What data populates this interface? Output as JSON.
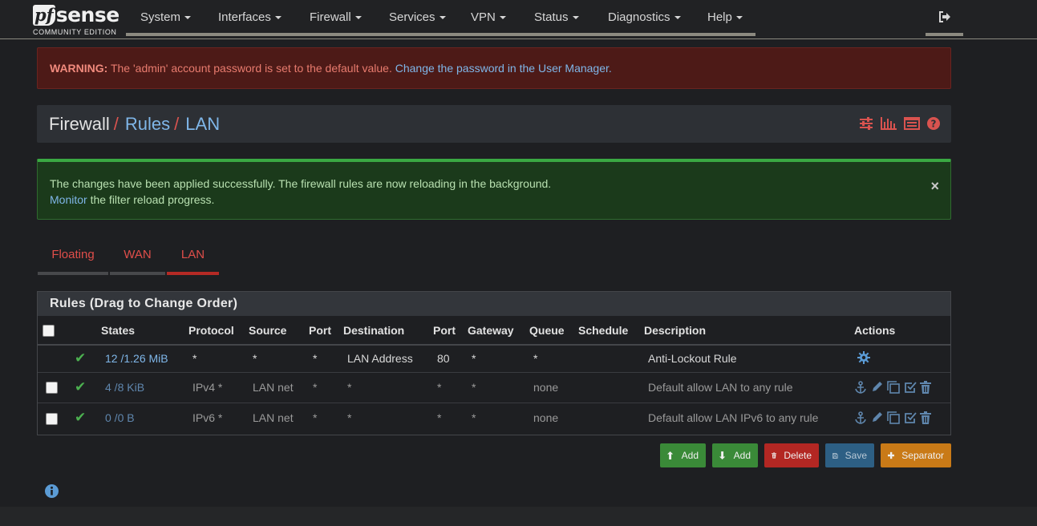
{
  "brand": {
    "logo_pf": "pf",
    "logo_sense": "sense",
    "edition": "COMMUNITY EDITION"
  },
  "nav": {
    "items": [
      "System",
      "Interfaces",
      "Firewall",
      "Services",
      "VPN",
      "Status",
      "Diagnostics",
      "Help"
    ]
  },
  "warning": {
    "label": "WARNING:",
    "text": " The 'admin' account password is set to the default value. ",
    "link": "Change the password in the User Manager."
  },
  "breadcrumb": {
    "part1": "Firewall",
    "part2": "Rules",
    "part3": "LAN",
    "separator": "/"
  },
  "success": {
    "line1": "The changes have been applied successfully. The firewall rules are now reloading in the background.",
    "link": "Monitor",
    "line2_rest": " the filter reload progress.",
    "close": "×"
  },
  "tabs": [
    "Floating",
    "WAN",
    "LAN"
  ],
  "active_tab": "LAN",
  "panel": {
    "title": "Rules (Drag to Change Order)",
    "columns": [
      "States",
      "Protocol",
      "Source",
      "Port",
      "Destination",
      "Port",
      "Gateway",
      "Queue",
      "Schedule",
      "Description",
      "Actions"
    ],
    "rows": [
      {
        "states": "12 /1.26 MiB",
        "protocol": "*",
        "source": "*",
        "sport": "*",
        "destination": "LAN Address",
        "dport": "80",
        "gateway": "*",
        "queue": "*",
        "schedule": "",
        "description": "Anti-Lockout Rule"
      },
      {
        "states": "4 /8 KiB",
        "protocol": "IPv4 *",
        "source": "LAN net",
        "sport": "*",
        "destination": "*",
        "dport": "*",
        "gateway": "*",
        "queue": "none",
        "schedule": "",
        "description": "Default allow LAN to any rule"
      },
      {
        "states": "0 /0 B",
        "protocol": "IPv6 *",
        "source": "LAN net",
        "sport": "*",
        "destination": "*",
        "dport": "*",
        "gateway": "*",
        "queue": "none",
        "schedule": "",
        "description": "Default allow LAN IPv6 to any rule"
      }
    ]
  },
  "buttons": {
    "add_top": "Add",
    "add_bottom": "Add",
    "delete": "Delete",
    "save": "Save",
    "separator": "Separator"
  },
  "colors": {
    "accent_red": "#d9534f",
    "link_blue": "#7fb6e8",
    "success_green": "#3aa843",
    "button_orange": "#c97a17"
  }
}
